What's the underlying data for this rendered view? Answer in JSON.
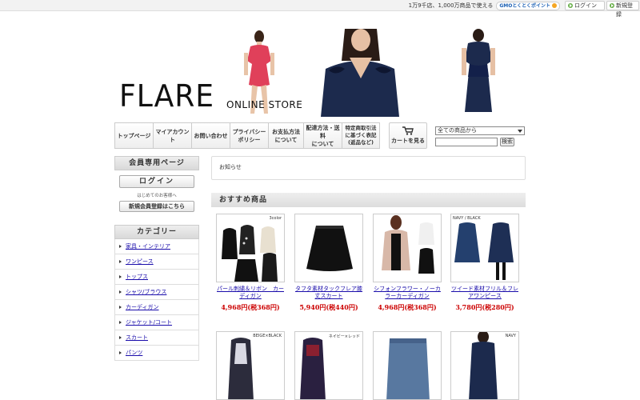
{
  "topbar": {
    "promo_text": "1万9千店、1,000万商品で使える",
    "gmo_label": "GMOとくとくポイント",
    "login_label": "ログイン",
    "register_label": "新規登録"
  },
  "header": {
    "logo": "FLARE",
    "logo_sub": "ONLINE STORE"
  },
  "nav": {
    "items": [
      "トップページ",
      "マイアカウント",
      "お問い合わせ",
      "プライバシー\nポリシー",
      "お支払方法\nについて",
      "配達方法・送料\nについて",
      "特定商取引法\nに基づく表記\n(返品など)"
    ],
    "cart_label": "カートを見る"
  },
  "search": {
    "category_selected": "全ての商品から",
    "button_label": "検索"
  },
  "sidebar": {
    "member_header": "会員専用ページ",
    "login_label": "ログイン",
    "first_time": "はじめてのお客様へ",
    "register_label": "新規会員登録はこちら",
    "category_header": "カテゴリー",
    "categories": [
      "家具・インテリア",
      "ワンピース",
      "トップス",
      "シャツ/ブラウス",
      "カーディガン",
      "ジャケット/コート",
      "スカート",
      "パンツ"
    ]
  },
  "main": {
    "news_label": "お知らせ",
    "recommend_header": "おすすめ商品",
    "products": [
      {
        "name": "パール刺繍＆リボン　カーディガン",
        "price": "4,968円(税368円)",
        "tag": "3color"
      },
      {
        "name": "タフタ素材タックフレア膝丈スカート",
        "price": "5,940円(税440円)",
        "tag": ""
      },
      {
        "name": "シフォンフラワー・ノーカラーカーディガン",
        "price": "4,968円(税368円)",
        "tag": ""
      },
      {
        "name": "ツイード素材フリル＆フレアワンピース",
        "price": "3,780円(税280円)",
        "tag": "NAVY / BLACK"
      },
      {
        "name": "",
        "price": "",
        "tag": "BEIGE×BLACK"
      },
      {
        "name": "",
        "price": "",
        "tag": "ネイビー×レッド"
      },
      {
        "name": "",
        "price": "",
        "tag": ""
      },
      {
        "name": "",
        "price": "",
        "tag": "NAVY"
      }
    ]
  },
  "colors": {
    "price_red": "#cc0000",
    "link_blue": "#1a0dab",
    "dress_red": "#e0405a",
    "dress_navy": "#1c2a4d"
  }
}
